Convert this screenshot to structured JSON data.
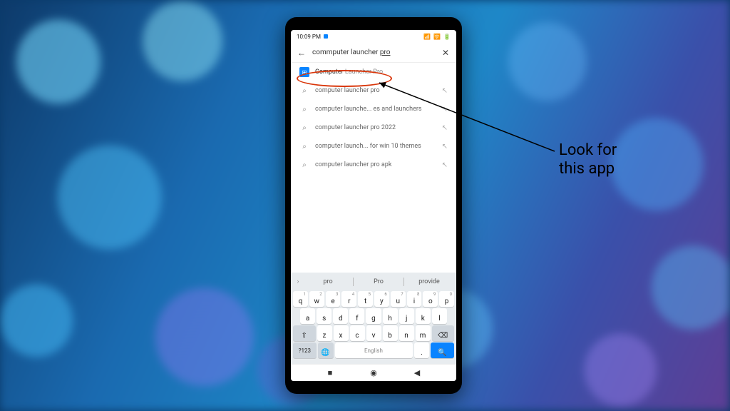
{
  "status": {
    "time": "10:09 PM"
  },
  "search": {
    "query_plain": "commputer launcher ",
    "query_underlined": "pro"
  },
  "suggestions": [
    {
      "label_plain": "Computer ",
      "label_dim": "Launcher Pro",
      "kind": "app"
    },
    {
      "label": "computer launcher pro",
      "kind": "search"
    },
    {
      "label": "computer launche... es and launchers",
      "kind": "search"
    },
    {
      "label": "computer launcher pro 2022",
      "kind": "search"
    },
    {
      "label": "computer launch... for win 10 themes",
      "kind": "search"
    },
    {
      "label": "computer launcher pro apk",
      "kind": "search"
    }
  ],
  "keyboard": {
    "predictions": [
      "pro",
      "Pro",
      "provide"
    ],
    "row1": [
      "q",
      "w",
      "e",
      "r",
      "t",
      "y",
      "u",
      "i",
      "o",
      "p"
    ],
    "row1nums": [
      "1",
      "2",
      "3",
      "4",
      "5",
      "6",
      "7",
      "8",
      "9",
      "0"
    ],
    "row2": [
      "a",
      "s",
      "d",
      "f",
      "g",
      "h",
      "j",
      "k",
      "l"
    ],
    "row3": [
      "z",
      "x",
      "c",
      "v",
      "b",
      "n",
      "m"
    ],
    "special": {
      "shift": "⇧",
      "backspace": "⌫",
      "sym": "?123",
      "emoji": "🌐",
      "space": "English",
      "dot": ".",
      "search": "🔍"
    }
  },
  "annotation": {
    "line1": "Look for",
    "line2": "this app"
  }
}
